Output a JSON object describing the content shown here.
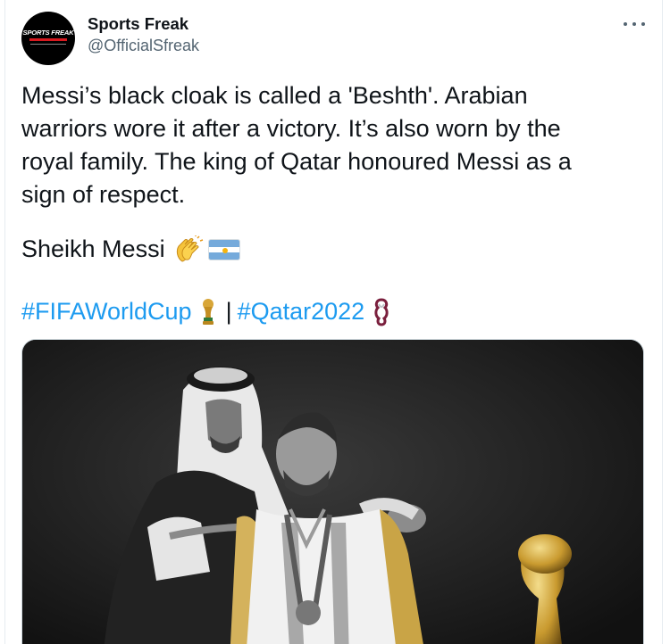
{
  "author": {
    "display_name": "Sports Freak",
    "handle": "@OfficialSfreak",
    "avatar_logo_text": "SPORTS FREAK"
  },
  "more_menu": {
    "icon": "more-horizontal-icon"
  },
  "tweet": {
    "lines": [
      "Messi’s black cloak is called a 'Beshth'. Arabian",
      "warriors wore it after a victory. It’s also worn by the",
      "royal family. The king of Qatar honoured Messi as a",
      "sign of respect."
    ],
    "signoff": "Sheikh Messi",
    "signoff_emojis": [
      "clapping-hands-emoji",
      "argentina-flag-emoji"
    ],
    "hashtags": [
      "#FIFAWorldCup",
      "#Qatar2022"
    ],
    "separator": "|",
    "hashtag_emojis": [
      "world-cup-trophy-emoji",
      "qatar-2022-emblem-emoji"
    ]
  },
  "media": {
    "kind": "photo",
    "style": "black-and-white"
  },
  "colors": {
    "link": "#1d9bf0",
    "text": "#0f1419",
    "secondary": "#536471",
    "border": "#cfd9de"
  }
}
